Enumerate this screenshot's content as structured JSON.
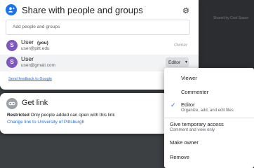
{
  "background": {
    "caption": "Shared by Cool Space"
  },
  "dialog": {
    "title": "Share with people and groups",
    "add_placeholder": "Add people and groups",
    "people": [
      {
        "initial": "S",
        "name": "User",
        "you_tag": "(you)",
        "email": "user@pitt.edu",
        "role": "Owner"
      },
      {
        "initial": "S",
        "name": "User",
        "email": "user@gmail.com",
        "role": "Editor"
      }
    ],
    "feedback_link": "Send feedback to Google"
  },
  "get_link": {
    "title": "Get link",
    "restriction": "Restricted",
    "restriction_desc": "Only people added can open with this link",
    "change_link": "Change link to University of Pittsburgh"
  },
  "role_menu": {
    "items": [
      {
        "label": "Viewer",
        "checked": false
      },
      {
        "label": "Commenter",
        "checked": false
      },
      {
        "label": "Editor",
        "sublabel": "Organize, add, and edit files",
        "checked": true
      }
    ],
    "temp_access": {
      "label": "Give temporary access",
      "sublabel": "Comment and view only"
    },
    "make_owner": "Make owner",
    "remove": "Remove"
  },
  "icons": {
    "share": "person-add-icon",
    "settings": "gear-icon",
    "link": "link-icon",
    "check": "check-icon",
    "caret": "caret-down-icon"
  },
  "colors": {
    "accent": "#1a73e8",
    "avatar": "#7e57c2"
  }
}
